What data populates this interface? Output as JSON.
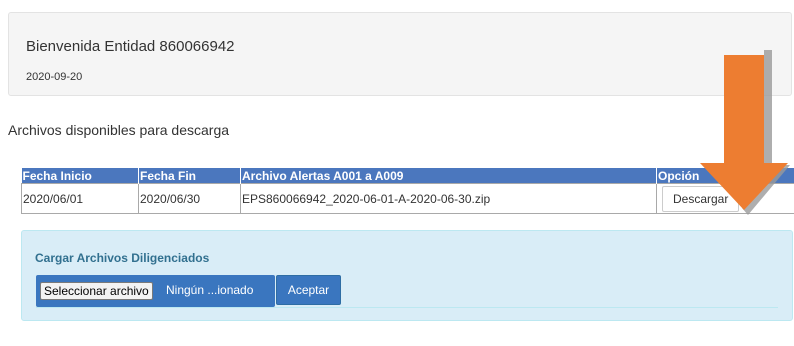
{
  "welcome": {
    "title": "Bienvenida Entidad 860066942",
    "date": "2020-09-20"
  },
  "downloads": {
    "section_title": "Archivos disponibles para descarga",
    "columns": [
      "Fecha Inicio",
      "Fecha Fin",
      "Archivo Alertas A001 a A009",
      "Opción"
    ],
    "rows": [
      {
        "start": "2020/06/01",
        "end": "2020/06/30",
        "file": "EPS860066942_2020-06-01-A-2020-06-30.zip",
        "action": "Descargar"
      }
    ]
  },
  "upload": {
    "title": "Cargar Archivos Diligenciados",
    "choose_label": "Seleccionar archivo",
    "file_status": "Ningún ...ionado",
    "accept_label": "Aceptar"
  },
  "annotation": {
    "icon": "arrow-down-icon",
    "color": "#ed7d31"
  },
  "colors": {
    "table_header": "#4b77be",
    "primary_button": "#3a76bf",
    "panel_bg": "#d9edf7",
    "panel_title": "#31708f"
  }
}
